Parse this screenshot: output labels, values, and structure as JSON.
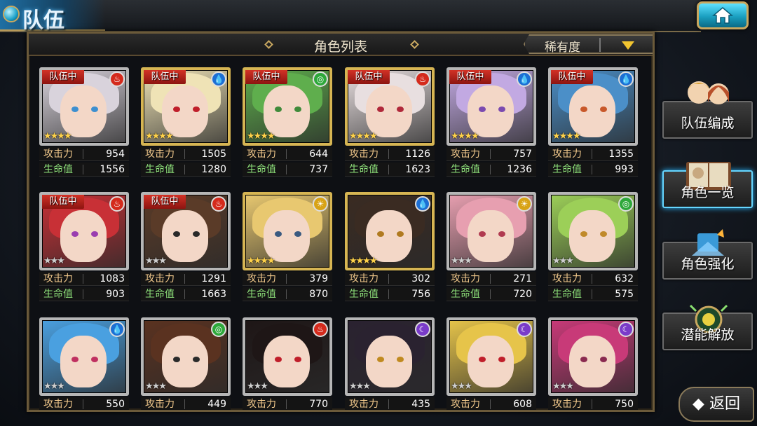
{
  "header": {
    "title": "队伍"
  },
  "panel": {
    "title": "角色列表",
    "sort_label": "稀有度"
  },
  "side_menu": [
    {
      "label": "队伍编成",
      "icon": "party-members-icon"
    },
    {
      "label": "角色一览",
      "icon": "book-icon"
    },
    {
      "label": "角色强化",
      "icon": "power-up-icon"
    },
    {
      "label": "潜能解放",
      "icon": "potential-orb-icon"
    }
  ],
  "back_label": "返回",
  "labels": {
    "atk": "攻击力",
    "hp": "生命值",
    "party": "队伍中"
  },
  "element_colors": {
    "fire": "#d42a1c",
    "water": "#1c6fd4",
    "wind": "#2da83a",
    "light": "#d8a316",
    "dark": "#7a3bc9"
  },
  "cards": [
    {
      "in_party": true,
      "element": "fire",
      "stars": 4,
      "frame": "silver",
      "atk": "954",
      "hp": "1556",
      "hair": "#d9d3dc",
      "eye": "#3c8fd0"
    },
    {
      "in_party": true,
      "element": "water",
      "stars": 4,
      "frame": "gold",
      "atk": "1505",
      "hp": "1280",
      "hair": "#efe3b6",
      "eye": "#c01e2a"
    },
    {
      "in_party": true,
      "element": "wind",
      "stars": 4,
      "frame": "gold",
      "atk": "644",
      "hp": "737",
      "hair": "#5fae4d",
      "eye": "#3f8a3a"
    },
    {
      "in_party": true,
      "element": "fire",
      "stars": 4,
      "frame": "gold",
      "atk": "1126",
      "hp": "1623",
      "hair": "#e8dfe0",
      "eye": "#b0283a"
    },
    {
      "in_party": true,
      "element": "water",
      "stars": 4,
      "frame": "silver",
      "atk": "757",
      "hp": "1236",
      "hair": "#c2a9e2",
      "eye": "#7b4ab0"
    },
    {
      "in_party": true,
      "element": "water",
      "stars": 4,
      "frame": "silver",
      "atk": "1355",
      "hp": "993",
      "hair": "#4b8fc8",
      "eye": "#c8582a"
    },
    {
      "in_party": true,
      "element": "fire",
      "stars": 3,
      "frame": "silver",
      "atk": "1083",
      "hp": "903",
      "hair": "#c83036",
      "eye": "#9a3db0"
    },
    {
      "in_party": true,
      "element": "fire",
      "stars": 3,
      "frame": "silver",
      "atk": "1291",
      "hp": "1663",
      "hair": "#5a3b28",
      "eye": "#2a2a2a"
    },
    {
      "in_party": false,
      "element": "light",
      "stars": 4,
      "frame": "gold",
      "atk": "379",
      "hp": "870",
      "hair": "#e8c870",
      "eye": "#3a5a80"
    },
    {
      "in_party": false,
      "element": "water",
      "stars": 4,
      "frame": "gold",
      "atk": "302",
      "hp": "756",
      "hair": "#3a2b22",
      "eye": "#b07a20"
    },
    {
      "in_party": false,
      "element": "light",
      "stars": 3,
      "frame": "silver",
      "atk": "271",
      "hp": "720",
      "hair": "#e79fb0",
      "eye": "#b03a50"
    },
    {
      "in_party": false,
      "element": "wind",
      "stars": 3,
      "frame": "silver",
      "atk": "632",
      "hp": "575",
      "hair": "#9ccf58",
      "eye": "#c08a2a"
    },
    {
      "in_party": false,
      "element": "water",
      "stars": 3,
      "frame": "silver",
      "atk": "550",
      "hp": "",
      "hair": "#4aa0e0",
      "eye": "#c03060"
    },
    {
      "in_party": false,
      "element": "wind",
      "stars": 3,
      "frame": "silver",
      "atk": "449",
      "hp": "",
      "hair": "#5a3220",
      "eye": "#2a2a2a"
    },
    {
      "in_party": false,
      "element": "fire",
      "stars": 3,
      "frame": "silver",
      "atk": "770",
      "hp": "",
      "hair": "#1e1616",
      "eye": "#c01e2a"
    },
    {
      "in_party": false,
      "element": "dark",
      "stars": 3,
      "frame": "silver",
      "atk": "435",
      "hp": "",
      "hair": "#2a2230",
      "eye": "#c08a20"
    },
    {
      "in_party": false,
      "element": "dark",
      "stars": 3,
      "frame": "silver",
      "atk": "608",
      "hp": "",
      "hair": "#e6c44a",
      "eye": "#c01e2a"
    },
    {
      "in_party": false,
      "element": "dark",
      "stars": 3,
      "frame": "silver",
      "atk": "750",
      "hp": "",
      "hair": "#c83a78",
      "eye": "#8a2a50"
    }
  ]
}
